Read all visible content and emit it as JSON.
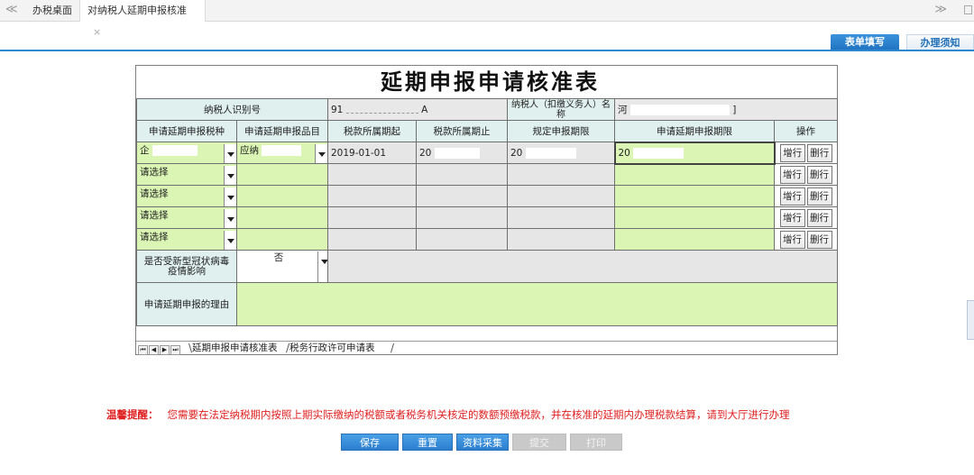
{
  "topbar": {
    "nav_left": "≪",
    "nav_right": "≫",
    "tabs": [
      {
        "label": "办税桌面"
      },
      {
        "label": "对纳税人延期申报核准",
        "close": "×"
      }
    ]
  },
  "subtabs": {
    "active": "表单填写",
    "inactive": "办理须知"
  },
  "form": {
    "title": "延期申报申请核准表",
    "taxpayer_id_label": "纳税人识别号",
    "taxpayer_id_value": "91",
    "taxpayer_id_tail": "A",
    "taxpayer_name_label": "纳税人（扣缴义务人）名称",
    "taxpayer_name_value": "河",
    "taxpayer_name_tail": "]",
    "headers": {
      "tax_type": "申请延期申报税种",
      "tax_item": "申请延期申报品目",
      "period_start": "税款所属期起",
      "period_end": "税款所属期止",
      "deadline": "规定申报期限",
      "apply_deadline": "申请延期申报期限",
      "ops": "操作"
    },
    "row1": {
      "tax_type": "企",
      "tax_item": "应纳",
      "period_start": "2019-01-01",
      "period_end": "20",
      "deadline": "20",
      "apply_deadline": "20"
    },
    "placeholder": "请选择",
    "add_row": "增行",
    "del_row": "删行",
    "covid_label": "是否受新型冠状病毒疫情影响",
    "covid_value": "否",
    "reason_label": "申请延期申报的理由",
    "sheet_tabs": [
      "延期申报申请核准表",
      "税务行政许可申请表"
    ]
  },
  "reminder": {
    "label": "温馨提醒：",
    "text": "您需要在法定纳税期内按照上期实际缴纳的税额或者税务机关核定的数额预缴税款，并在核准的延期内办理税款结算，请到大厅进行办理"
  },
  "buttons": {
    "save": "保存",
    "reset": "重置",
    "collect": "资料采集",
    "submit": "提交",
    "print": "打印"
  }
}
